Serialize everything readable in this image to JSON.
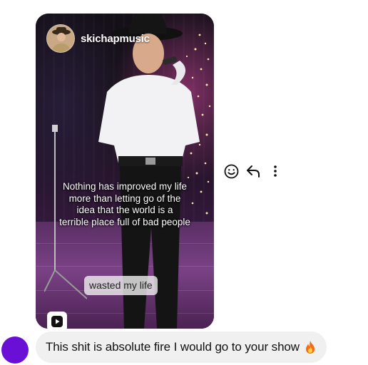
{
  "shared_reel": {
    "username": "skichapmusic",
    "caption_lines": [
      "Nothing has improved my life",
      "more than letting go of the",
      "idea that the world is a",
      "terrible place full of bad people"
    ],
    "sticker_text": "wasted my life",
    "play_icon": "reels-play-icon"
  },
  "actions": {
    "react_icon": "smiley-face-icon",
    "reply_icon": "reply-arrow-icon",
    "more_icon": "more-vertical-icon"
  },
  "message": {
    "text": "This shit is absolute fire I would go to your show",
    "emoji_icon": "fire-emoji-icon",
    "bubble_color": "#f0f0f0"
  },
  "sender_avatar_color": "#6a0fd6"
}
